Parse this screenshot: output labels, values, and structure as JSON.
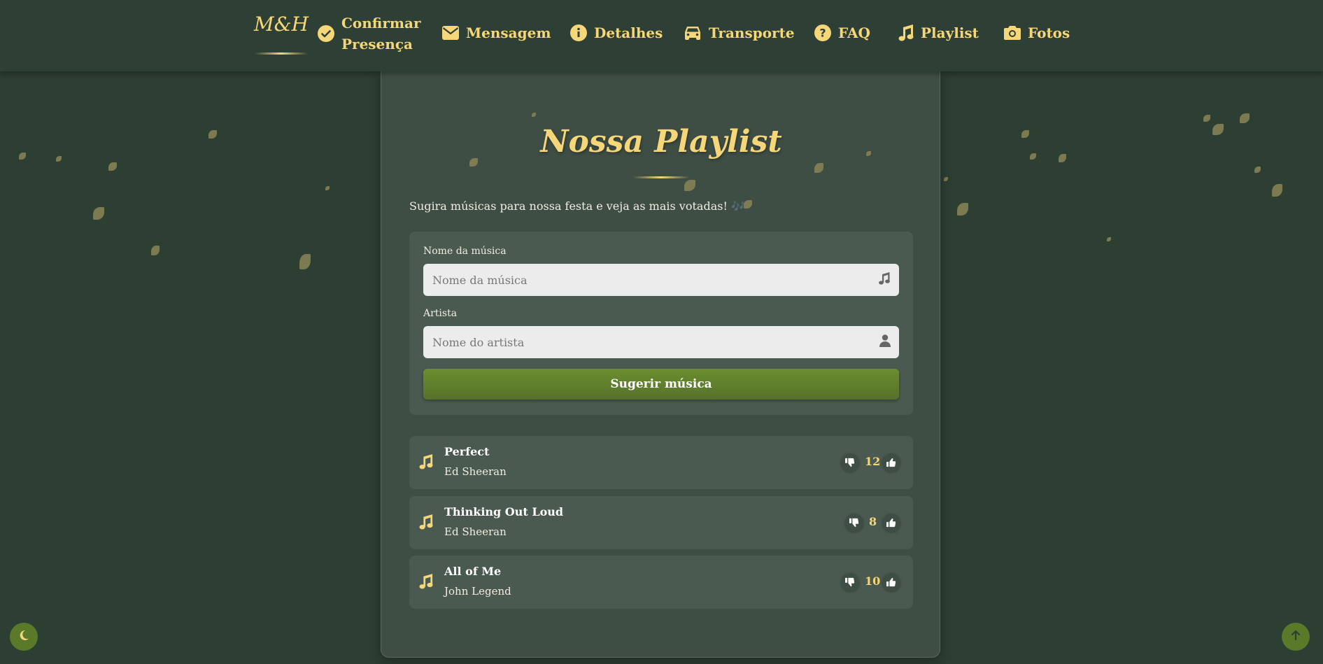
{
  "nav": {
    "brand": "M&H",
    "items": [
      {
        "label_line1": "Confirmar",
        "label_line2": "Presença",
        "icon": "check-circle-icon"
      },
      {
        "label": "Mensagem",
        "icon": "envelope-icon"
      },
      {
        "label": "Detalhes",
        "icon": "info-circle-icon"
      },
      {
        "label": "Transporte",
        "icon": "car-icon"
      },
      {
        "label": "FAQ",
        "icon": "question-circle-icon"
      },
      {
        "label": "Playlist",
        "icon": "music-note-icon"
      },
      {
        "label": "Fotos",
        "icon": "camera-icon"
      }
    ]
  },
  "page": {
    "title": "Nossa Playlist",
    "subtitle": "Sugira músicas para nossa festa e veja as mais votadas! 🎶"
  },
  "form": {
    "song_label": "Nome da música",
    "song_placeholder": "Nome da música",
    "artist_label": "Artista",
    "artist_placeholder": "Nome do artista",
    "submit_label": "Sugerir música"
  },
  "songs": [
    {
      "name": "Perfect",
      "artist": "Ed Sheeran",
      "votes": "12"
    },
    {
      "name": "Thinking Out Loud",
      "artist": "Ed Sheeran",
      "votes": "8"
    },
    {
      "name": "All of Me",
      "artist": "John Legend",
      "votes": "10"
    }
  ],
  "colors": {
    "background": "#2d3e33",
    "card": "#3f4e45",
    "accent_gold": "#f5d77a",
    "button_green": "#6c8d2f"
  },
  "floating": {
    "theme_toggle_icon": "moon-icon",
    "scroll_top_icon": "arrow-up-icon"
  }
}
